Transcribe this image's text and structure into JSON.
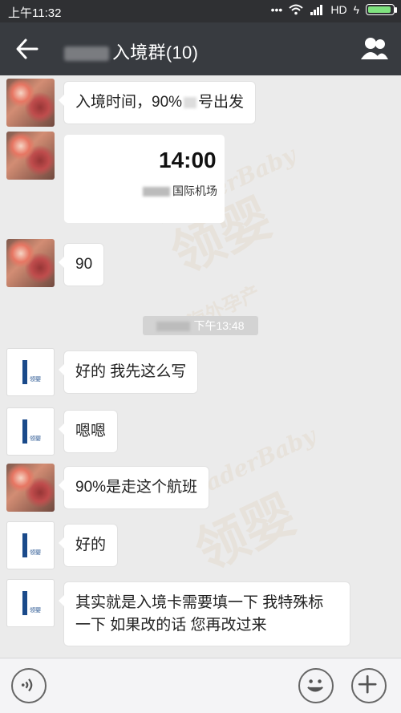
{
  "status_bar": {
    "time": "上午11:32",
    "network": "HD",
    "wifi_icon": "wifi-icon",
    "signal_icon": "signal-icon",
    "battery_icon": "battery-icon"
  },
  "header": {
    "title": "入境群(10)",
    "back_icon": "back-arrow-icon",
    "group_icon": "group-members-icon"
  },
  "timestamp": "下午13:48",
  "flight_card": {
    "time": "14:00",
    "airport": "国际机场"
  },
  "messages": [
    {
      "text": "入境时间，90%",
      "text_after": "号出发"
    },
    {
      "text": "90"
    },
    {
      "text": "好的 我先这么写"
    },
    {
      "text": "嗯嗯"
    },
    {
      "text": "90%是走这个航班"
    },
    {
      "text": "好的"
    },
    {
      "text": "其实就是入境卡需要填一下 我特殊标一下 如果改的话 您再改过来"
    }
  ],
  "watermark": {
    "brand": "LeaderBaby",
    "chars": "领婴",
    "tagline": "海外孕产"
  },
  "input_bar": {
    "voice_icon": "voice-icon",
    "emoji_icon": "emoji-icon",
    "plus_icon": "plus-icon"
  }
}
